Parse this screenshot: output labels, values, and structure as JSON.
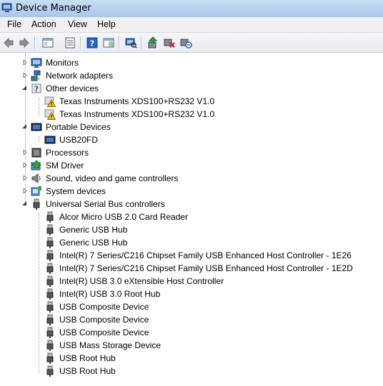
{
  "window": {
    "title": "Device Manager"
  },
  "menu": [
    "File",
    "Action",
    "View",
    "Help"
  ],
  "toolbar": {
    "buttons": [
      "back-icon",
      "forward-icon",
      "tree-view-icon",
      "properties-icon",
      "help-icon",
      "console-icon",
      "scan-hardware-icon",
      "update-driver-icon",
      "uninstall-icon",
      "disable-icon"
    ]
  },
  "tree": {
    "monitors": "Monitors",
    "network": "Network adapters",
    "other": "Other devices",
    "other_children": [
      "Texas Instruments XDS100+RS232 V1.0",
      "Texas Instruments XDS100+RS232 V1.0"
    ],
    "portable": "Portable Devices",
    "portable_children": [
      "USB20FD"
    ],
    "processors": "Processors",
    "sm_driver": "SM Driver",
    "sound": "Sound, video and game controllers",
    "system": "System devices",
    "usb": "Universal Serial Bus controllers",
    "usb_children": [
      "Alcor Micro USB 2.0 Card Reader",
      "Generic USB Hub",
      "Generic USB Hub",
      "Intel(R) 7 Series/C216 Chipset Family USB Enhanced Host Controller - 1E26",
      "Intel(R) 7 Series/C216 Chipset Family USB Enhanced Host Controller - 1E2D",
      "Intel(R) USB 3.0 eXtensible Host Controller",
      "Intel(R) USB 3.0 Root Hub",
      "USB Composite Device",
      "USB Composite Device",
      "USB Composite Device",
      "USB Mass Storage Device",
      "USB Root Hub",
      "USB Root Hub"
    ]
  }
}
